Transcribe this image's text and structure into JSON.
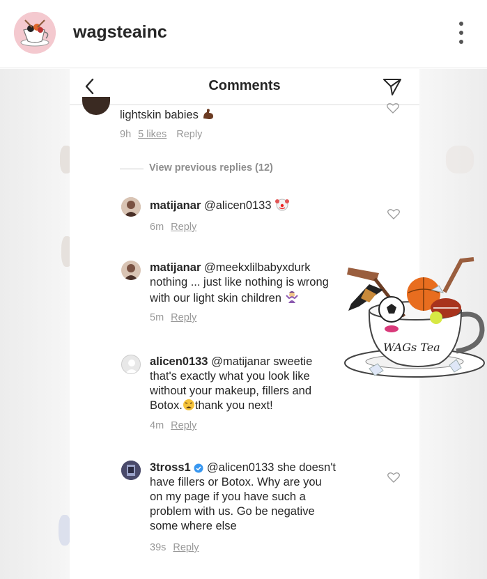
{
  "post": {
    "username": "wagsteainc"
  },
  "comments_header": {
    "title": "Comments"
  },
  "top_comment": {
    "text": "lightskin babies",
    "time": "9h",
    "likes": "5 likes",
    "reply": "Reply"
  },
  "view_previous": "View previous replies (12)",
  "replies": [
    {
      "username": "matijanar",
      "mention": "@alicen0133",
      "lines": [],
      "time": "6m",
      "reply": "Reply"
    },
    {
      "username": "matijanar",
      "mention": "@meekxlilbabyxdurk",
      "lines": [
        "nothing ... just like nothing is wrong",
        "with our light skin children"
      ],
      "time": "5m",
      "reply": "Reply"
    },
    {
      "username": "alicen0133",
      "mention": "@matijanar",
      "first_rest": "sweetie",
      "lines": [
        "that's exactly what you look like",
        "without your makeup, fillers and",
        "Botox.",
        "thank you next!"
      ],
      "time": "4m",
      "reply": "Reply"
    },
    {
      "username": "3tross1",
      "mention": "@alicen0133",
      "first_rest": "she doesn't",
      "lines": [
        "have fillers or Botox. Why are you",
        "on my page if you have such a",
        "problem with us. Go be negative",
        "some where else"
      ],
      "time": "39s",
      "reply": "Reply"
    }
  ],
  "watermark": {
    "text": "WAGs Tea"
  },
  "colors": {
    "verified": "#3897f0",
    "meta_gray": "#999999"
  }
}
